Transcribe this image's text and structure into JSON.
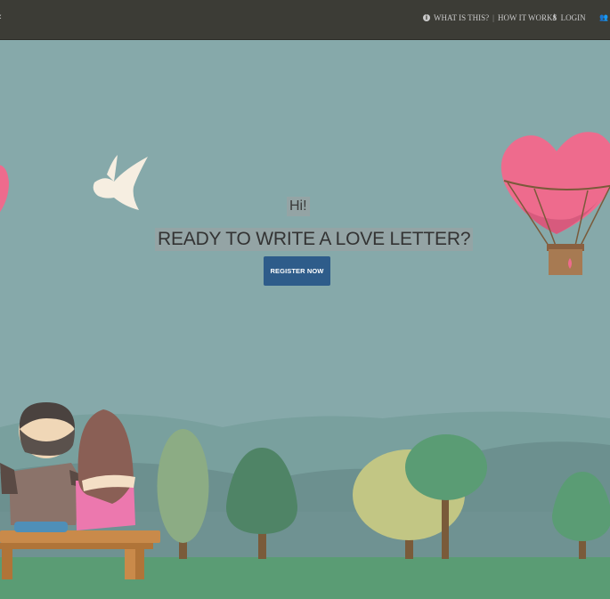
{
  "navbar": {
    "menu_glyph": "‹",
    "info_icon_glyph": "i",
    "what_is_this": "WHAT IS THIS?",
    "separator": "|",
    "how_it_works": "HOW IT WORKS",
    "login_icon_glyph": "⚷",
    "login": "LOGIN",
    "users_icon_glyph": "👥"
  },
  "hero": {
    "greeting": "Hi!",
    "headline": "READY TO WRITE A LOVE LETTER?",
    "register_button": "REGISTER NOW"
  },
  "colors": {
    "navbar": "#3c3c36",
    "sky": "#86a9aa",
    "button": "#2e5c8a",
    "grass": "#5a9c74",
    "heart": "#ee6b8d"
  }
}
